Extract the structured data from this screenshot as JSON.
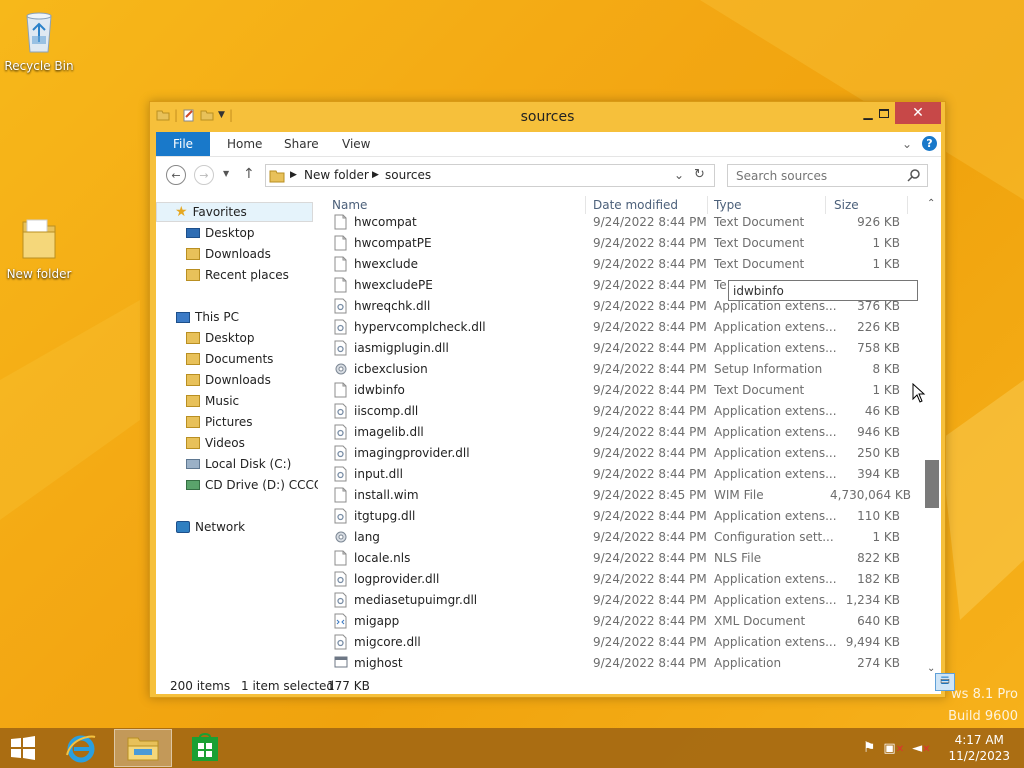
{
  "desktop": {
    "icons": [
      {
        "label": "Recycle Bin"
      },
      {
        "label": "New folder"
      }
    ],
    "watermark": {
      "line1": "ws 8.1 Pro",
      "line2": "Build 9600"
    }
  },
  "window": {
    "title": "sources",
    "ribbon_tabs": [
      "File",
      "Home",
      "Share",
      "View"
    ],
    "address": {
      "segments": [
        "New folder",
        "sources"
      ]
    },
    "search_placeholder": "Search sources"
  },
  "nav": {
    "favorites": "Favorites",
    "favorites_items": [
      "Desktop",
      "Downloads",
      "Recent places"
    ],
    "thispc": "This PC",
    "thispc_items": [
      "Desktop",
      "Documents",
      "Downloads",
      "Music",
      "Pictures",
      "Videos",
      "Local Disk (C:)",
      "CD Drive (D:) CCCOI"
    ],
    "network": "Network"
  },
  "columns": [
    "Name",
    "Date modified",
    "Type",
    "Size"
  ],
  "files": [
    {
      "name": "hwcompat",
      "date": "9/24/2022 8:44 PM",
      "type": "Text Document",
      "size": "926 KB",
      "icon": "doc"
    },
    {
      "name": "hwcompatPE",
      "date": "9/24/2022 8:44 PM",
      "type": "Text Document",
      "size": "1 KB",
      "icon": "doc"
    },
    {
      "name": "hwexclude",
      "date": "9/24/2022 8:44 PM",
      "type": "Text Document",
      "size": "1 KB",
      "icon": "doc"
    },
    {
      "name": "hwexcludePE",
      "date": "9/24/2022 8:44 PM",
      "type": "Te",
      "size": "",
      "icon": "doc"
    },
    {
      "name": "hwreqchk.dll",
      "date": "9/24/2022 8:44 PM",
      "type": "Application extens...",
      "size": "376 KB",
      "icon": "dll"
    },
    {
      "name": "hypervcomplcheck.dll",
      "date": "9/24/2022 8:44 PM",
      "type": "Application extens...",
      "size": "226 KB",
      "icon": "dll"
    },
    {
      "name": "iasmigplugin.dll",
      "date": "9/24/2022 8:44 PM",
      "type": "Application extens...",
      "size": "758 KB",
      "icon": "dll"
    },
    {
      "name": "icbexclusion",
      "date": "9/24/2022 8:44 PM",
      "type": "Setup Information",
      "size": "8 KB",
      "icon": "gear"
    },
    {
      "name": "idwbinfo",
      "date": "9/24/2022 8:44 PM",
      "type": "Text Document",
      "size": "1 KB",
      "icon": "doc"
    },
    {
      "name": "iiscomp.dll",
      "date": "9/24/2022 8:44 PM",
      "type": "Application extens...",
      "size": "46 KB",
      "icon": "dll"
    },
    {
      "name": "imagelib.dll",
      "date": "9/24/2022 8:44 PM",
      "type": "Application extens...",
      "size": "946 KB",
      "icon": "dll"
    },
    {
      "name": "imagingprovider.dll",
      "date": "9/24/2022 8:44 PM",
      "type": "Application extens...",
      "size": "250 KB",
      "icon": "dll"
    },
    {
      "name": "input.dll",
      "date": "9/24/2022 8:44 PM",
      "type": "Application extens...",
      "size": "394 KB",
      "icon": "dll"
    },
    {
      "name": "install.wim",
      "date": "9/24/2022 8:45 PM",
      "type": "WIM File",
      "size": "4,730,064 KB",
      "icon": "doc"
    },
    {
      "name": "itgtupg.dll",
      "date": "9/24/2022 8:44 PM",
      "type": "Application extens...",
      "size": "110 KB",
      "icon": "dll"
    },
    {
      "name": "lang",
      "date": "9/24/2022 8:44 PM",
      "type": "Configuration sett...",
      "size": "1 KB",
      "icon": "gear"
    },
    {
      "name": "locale.nls",
      "date": "9/24/2022 8:44 PM",
      "type": "NLS File",
      "size": "822 KB",
      "icon": "doc"
    },
    {
      "name": "logprovider.dll",
      "date": "9/24/2022 8:44 PM",
      "type": "Application extens...",
      "size": "182 KB",
      "icon": "dll"
    },
    {
      "name": "mediasetupuimgr.dll",
      "date": "9/24/2022 8:44 PM",
      "type": "Application extens...",
      "size": "1,234 KB",
      "icon": "dll"
    },
    {
      "name": "migapp",
      "date": "9/24/2022 8:44 PM",
      "type": "XML Document",
      "size": "640 KB",
      "icon": "xml"
    },
    {
      "name": "migcore.dll",
      "date": "9/24/2022 8:44 PM",
      "type": "Application extens...",
      "size": "9,494 KB",
      "icon": "dll"
    },
    {
      "name": "mighost",
      "date": "9/24/2022 8:44 PM",
      "type": "Application",
      "size": "274 KB",
      "icon": "app"
    }
  ],
  "tooltip": "idwbinfo",
  "status": {
    "items": "200 items",
    "selected": "1 item selected",
    "size": "177 KB"
  },
  "taskbar": {
    "time": "4:17 AM",
    "date": "11/2/2023"
  },
  "colors": {
    "accent": "#1979ca",
    "close": "#c74848",
    "desktop": "#f3a713"
  }
}
